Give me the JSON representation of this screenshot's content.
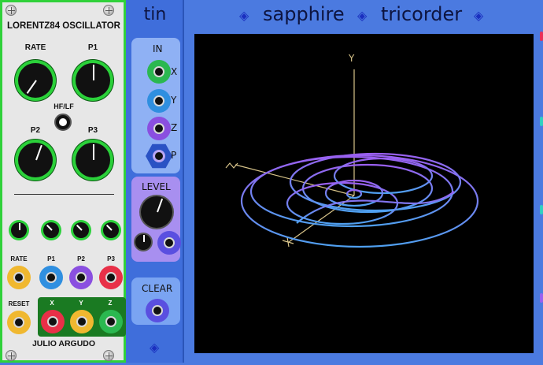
{
  "lorentz": {
    "title": "LORENTZ84 OSCILLATOR",
    "rate_label": "RATE",
    "p1_label": "P1",
    "hflf_label": "HF/LF",
    "p2_label": "P2",
    "p3_label": "P3",
    "cv_labels": [
      "RATE",
      "P1",
      "P2",
      "P3"
    ],
    "reset_label": "RESET",
    "out_labels": [
      "X",
      "Y",
      "Z"
    ],
    "author": "JULIO ARGUDO",
    "accent": "#30d13a"
  },
  "tin": {
    "title": "tin",
    "in_label": "IN",
    "x_label": "X",
    "y_label": "Y",
    "z_label": "Z",
    "p_label": "P",
    "level_label": "LEVEL",
    "clear_label": "CLEAR",
    "gem_icon": "diamond-icon"
  },
  "tricorder": {
    "title_left": "sapphire",
    "title_right": "tricorder",
    "axis_y": "Y",
    "gem_icon": "diamond-icon"
  }
}
